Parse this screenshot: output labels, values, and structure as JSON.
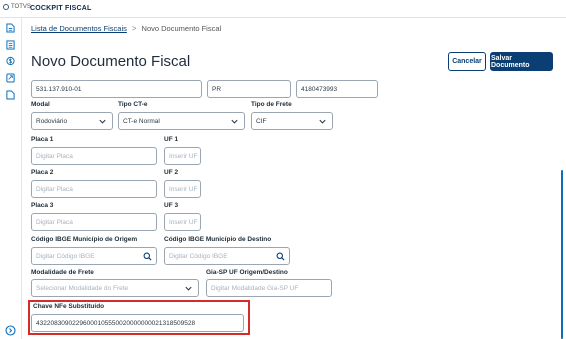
{
  "header": {
    "logo_text": "TOTVS",
    "app_title": "COCKPIT FISCAL"
  },
  "breadcrumb": {
    "link": "Lista de Documentos Fiscais",
    "separator": ">",
    "current": "Novo Documento Fiscal"
  },
  "page": {
    "title": "Novo Documento Fiscal"
  },
  "actions": {
    "cancel": "Cancelar",
    "save": "Salvar Documento"
  },
  "form": {
    "top_row": {
      "cnpj": "531.137.910-01",
      "uf": "PR",
      "ie": "4180473993"
    },
    "modal": {
      "label": "Modal",
      "value": "Rodoviário"
    },
    "tipo_cte": {
      "label": "Tipo CT-e",
      "value": "CT-e Normal"
    },
    "tipo_frete": {
      "label": "Tipo de Frete",
      "value": "CIF"
    },
    "placa1": {
      "label": "Placa 1",
      "placeholder": "Digitar Placa"
    },
    "uf1": {
      "label": "UF 1",
      "placeholder": "Inserir UF"
    },
    "placa2": {
      "label": "Placa 2",
      "placeholder": "Digitar Placa"
    },
    "uf2": {
      "label": "UF 2",
      "placeholder": "Inserir UF"
    },
    "placa3": {
      "label": "Placa 3",
      "placeholder": "Digitar Placa"
    },
    "uf3": {
      "label": "UF 3",
      "placeholder": "Inserir UF"
    },
    "ibge_origem": {
      "label": "Código IBGE Município de Origem",
      "placeholder": "Digitar Código IBGE"
    },
    "ibge_destino": {
      "label": "Código IBGE Município de Destino",
      "placeholder": "Digitar Código IBGE"
    },
    "modalidade_frete": {
      "label": "Modalidade de Frete",
      "placeholder": "Selecionar Modalidade do Frete"
    },
    "gia_sp": {
      "label": "Gia-SP UF Origem/Destino",
      "placeholder": "Digitar Modalidade Gia-SP UF"
    },
    "chave_nfe": {
      "label": "Chave NFe Substituído",
      "value": "43220830902296000105550020000000021318509528"
    }
  },
  "colors": {
    "primary": "#0b3f73",
    "accent": "#0b6fb8",
    "highlight": "#d62b2b"
  },
  "icons": [
    "document-icon",
    "list-icon",
    "dollar-icon",
    "export-icon",
    "file-icon",
    "help-icon",
    "chevron-down-icon",
    "search-icon"
  ]
}
